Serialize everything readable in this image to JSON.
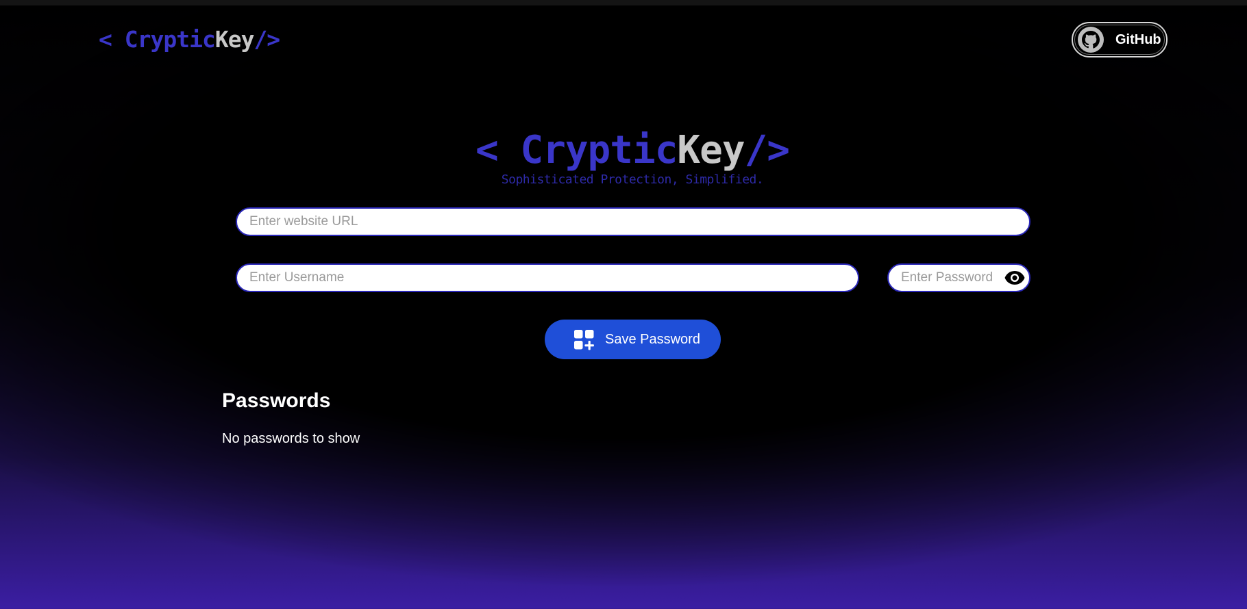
{
  "navbar": {
    "logo": {
      "open": "< ",
      "part1": "Cryptic",
      "part2": "Key",
      "close": "/>"
    },
    "github_label": "GitHub"
  },
  "hero": {
    "logo": {
      "open": "< ",
      "part1": "Cryptic",
      "part2": "Key",
      "close": "/>"
    },
    "tagline": "Sophisticated Protection, Simplified."
  },
  "form": {
    "url_placeholder": "Enter website URL",
    "url_value": "",
    "username_placeholder": "Enter Username",
    "username_value": "",
    "password_placeholder": "Enter Password",
    "password_value": "",
    "save_label": "Save Password"
  },
  "passwords": {
    "title": "Passwords",
    "empty_message": "No passwords to show"
  },
  "icons": {
    "github": "github-icon",
    "eye": "eye-icon",
    "save": "add-grid-icon"
  },
  "colors": {
    "accent": "#3a36c9",
    "button": "#1f4fd8",
    "gradient_bottom": "#3b1ea3"
  }
}
